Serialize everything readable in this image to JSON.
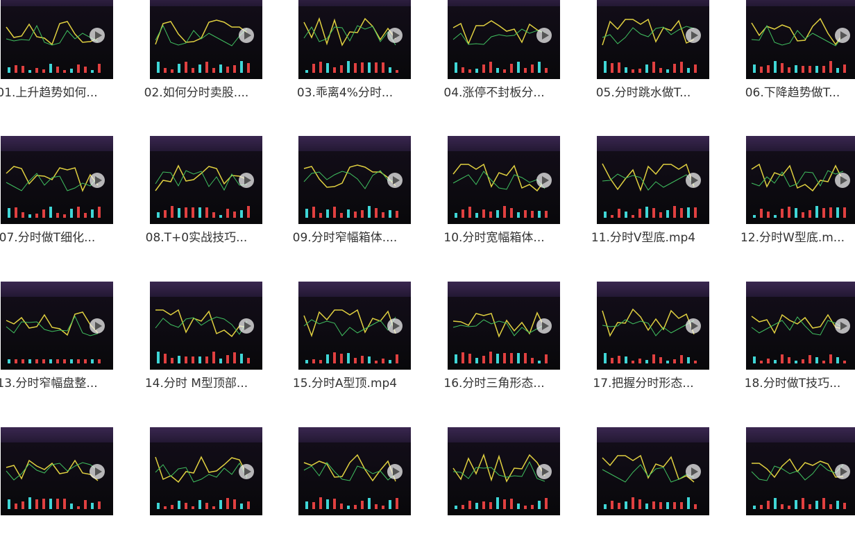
{
  "items": [
    {
      "label": "01.上升趋势如何..."
    },
    {
      "label": "02.如何分时卖股...."
    },
    {
      "label": "03.乖离4%分时..."
    },
    {
      "label": "04.涨停不封板分..."
    },
    {
      "label": "05.分时跳水做T..."
    },
    {
      "label": "06.下降趋势做T..."
    },
    {
      "label": "07.分时做T细化..."
    },
    {
      "label": "08.T+0实战技巧..."
    },
    {
      "label": "09.分时窄幅箱体...."
    },
    {
      "label": "10.分时宽幅箱体..."
    },
    {
      "label": "11.分时V型底.mp4"
    },
    {
      "label": "12.分时W型底.m..."
    },
    {
      "label": "13.分时窄幅盘整..."
    },
    {
      "label": "14.分时 M型顶部..."
    },
    {
      "label": "15.分时A型顶.mp4"
    },
    {
      "label": "16.分时三角形态..."
    },
    {
      "label": "17.把握分时形态..."
    },
    {
      "label": "18.分时做T技巧..."
    },
    {
      "label": ""
    },
    {
      "label": ""
    },
    {
      "label": ""
    },
    {
      "label": ""
    },
    {
      "label": ""
    },
    {
      "label": ""
    }
  ],
  "icons": {
    "play": "play-icon"
  }
}
